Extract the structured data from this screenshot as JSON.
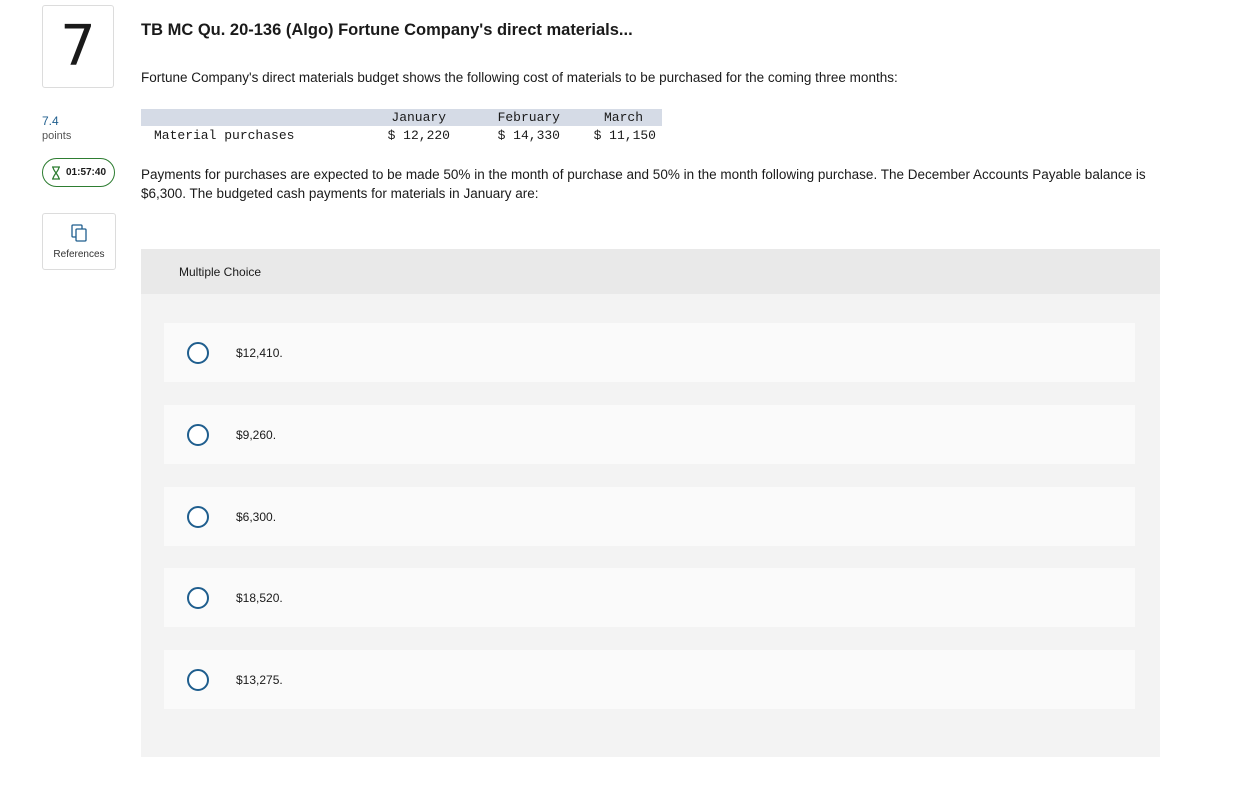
{
  "question": {
    "number": "7",
    "points_value": "7.4",
    "points_label": "points",
    "timer": "01:57:40",
    "references_label": "References",
    "title": "TB MC Qu. 20-136 (Algo) Fortune Company's direct materials...",
    "intro": "Fortune Company's direct materials budget shows the following cost of materials to be purchased for the coming three months:",
    "body": "Payments for purchases are expected to be made 50% in the month of purchase and 50% in the month following purchase. The December Accounts Payable balance is $6,300. The budgeted cash payments for materials in January are:"
  },
  "table": {
    "headers": [
      "",
      "January",
      "February",
      "March"
    ],
    "rows": [
      [
        "Material purchases",
        "$ 12,220",
        "$ 14,330",
        "$ 11,150"
      ]
    ]
  },
  "multiple_choice": {
    "header": "Multiple Choice",
    "options": [
      "$12,410.",
      "$9,260.",
      "$6,300.",
      "$18,520.",
      "$13,275."
    ]
  },
  "colors": {
    "accent": "#1f5e8e",
    "timer_border": "#2e7d32",
    "table_header_bg": "#d5dbe6",
    "panel_bg": "#f3f3f3",
    "panel_header_bg": "#e9e9e9",
    "option_bg": "#fafafa"
  },
  "icons": {
    "timer": "hourglass-icon",
    "references": "copy-pages-icon"
  }
}
